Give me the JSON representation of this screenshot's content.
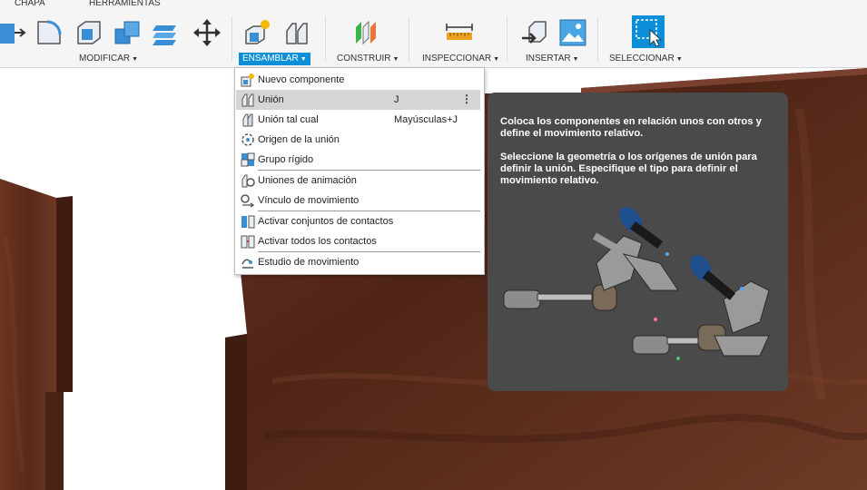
{
  "toolbar": {
    "tabs": [
      "CHAPA",
      "HERRAMIENTAS"
    ],
    "groups": [
      {
        "label": "MODIFICAR",
        "active": false
      },
      {
        "label": "ENSAMBLAR",
        "active": true
      },
      {
        "label": "CONSTRUIR",
        "active": false
      },
      {
        "label": "INSPECCIONAR",
        "active": false
      },
      {
        "label": "INSERTAR",
        "active": false
      },
      {
        "label": "SELECCIONAR",
        "active": false
      }
    ],
    "accent": "#0a8fd8"
  },
  "menu": {
    "items": [
      {
        "label": "Nuevo componente",
        "shortcut": "",
        "icon": "new-component-icon"
      },
      {
        "label": "Unión",
        "shortcut": "J",
        "icon": "joint-icon",
        "highlighted": true
      },
      {
        "label": "Unión tal cual",
        "shortcut": "Mayúsculas+J",
        "icon": "as-built-joint-icon"
      },
      {
        "label": "Origen de la unión",
        "shortcut": "",
        "icon": "joint-origin-icon"
      },
      {
        "label": "Grupo rígido",
        "shortcut": "",
        "icon": "rigid-group-icon"
      },
      {
        "label": "Uniones de animación",
        "shortcut": "",
        "icon": "drive-joints-icon"
      },
      {
        "label": "Vínculo de movimiento",
        "shortcut": "",
        "icon": "motion-link-icon"
      },
      {
        "label": "Activar conjuntos de contactos",
        "shortcut": "",
        "icon": "contact-sets-icon"
      },
      {
        "label": "Activar todos los contactos",
        "shortcut": "",
        "icon": "all-contacts-icon"
      },
      {
        "label": "Estudio de movimiento",
        "shortcut": "",
        "icon": "motion-study-icon"
      }
    ]
  },
  "tooltip": {
    "paragraph1": "Coloca los componentes en relación unos con otros y define el movimiento relativo.",
    "paragraph2": "Seleccione la geometría o los orígenes de unión para definir la unión. Especifique el tipo para definir el movimiento relativo.",
    "background": "#4a4a4a"
  },
  "colors": {
    "wood": "#5a2a1a",
    "wood_edge": "#3b1a10"
  }
}
